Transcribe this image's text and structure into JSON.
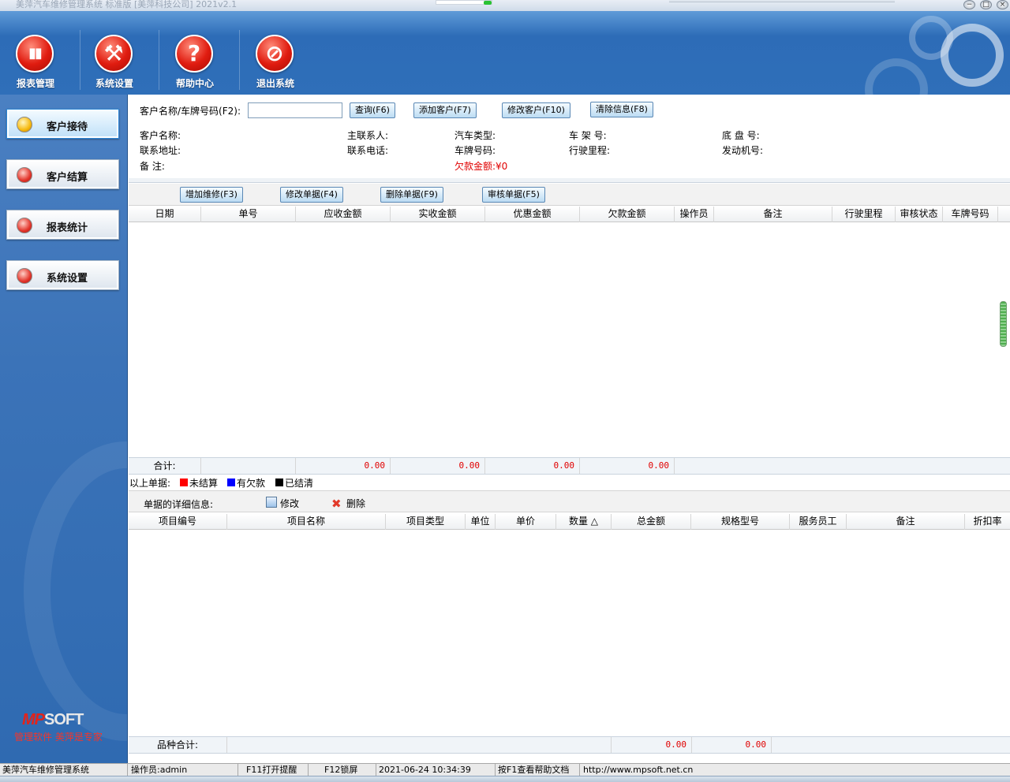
{
  "window": {
    "title": "美萍汽车维修管理系统 标准版 [美萍科技公司]    2021v2.1",
    "controls": [
      "−",
      "□",
      "×"
    ]
  },
  "toolbar": {
    "items": [
      {
        "label": "报表管理",
        "icon": "bar-chart-icon",
        "glyph": "▮▮"
      },
      {
        "label": "系统设置",
        "icon": "tools-icon",
        "glyph": "⚒"
      },
      {
        "label": "帮助中心",
        "icon": "help-icon",
        "glyph": "?"
      },
      {
        "label": "退出系统",
        "icon": "exit-icon",
        "glyph": "⊘"
      }
    ]
  },
  "sidebar": {
    "items": [
      {
        "label": "客户接待",
        "active": true
      },
      {
        "label": "客户结算",
        "active": false
      },
      {
        "label": "报表统计",
        "active": false
      },
      {
        "label": "系统设置",
        "active": false
      }
    ],
    "logo_prefix": "MP",
    "logo_suffix": "SOFT",
    "slogan": "管理软件 美萍是专家"
  },
  "search": {
    "label": "客户名称/车牌号码(F2):",
    "value": "",
    "buttons": [
      "查询(F6)",
      "添加客户(F7)",
      "修改客户(F10)",
      "清除信息(F8)"
    ]
  },
  "customer_info": {
    "name_label": "客户名称:",
    "address_label": "联系地址:",
    "remark_label": "备    注:",
    "contact_label": "主联系人:",
    "phone_label": "联系电话:",
    "car_type_label": "汽车类型:",
    "plate_label": "车牌号码:",
    "debt_label": "欠款金额:¥0",
    "frame_label": "车 架 号:",
    "mileage_label": "行驶里程:",
    "chassis_label": "底 盘 号:",
    "engine_label": "发动机号:"
  },
  "order_actions": [
    "增加维修(F3)",
    "修改单据(F4)",
    "删除单据(F9)",
    "审核单据(F5)"
  ],
  "orders_table": {
    "columns": [
      "日期",
      "单号",
      "应收金额",
      "实收金额",
      "优惠金额",
      "欠款金额",
      "操作员",
      "备注",
      "行驶里程",
      "审核状态",
      "车牌号码"
    ],
    "rows": [],
    "total_label": "合计:",
    "totals": [
      "0.00",
      "0.00",
      "0.00",
      "0.00"
    ]
  },
  "legend": {
    "prefix": "以上单据:",
    "items": [
      {
        "label": "未结算",
        "color": "#ff0000"
      },
      {
        "label": "有欠款",
        "color": "#0000ff"
      },
      {
        "label": "已结清",
        "color": "#000000"
      }
    ]
  },
  "detail": {
    "title": "单据的详细信息:",
    "edit_label": "修改",
    "delete_label": "删除",
    "columns": [
      "项目编号",
      "项目名称",
      "项目类型",
      "单位",
      "单价",
      "数量 △",
      "总金额",
      "规格型号",
      "服务员工",
      "备注",
      "折扣率"
    ],
    "rows": [],
    "total_label": "品种合计:",
    "totals": [
      "0.00",
      "0.00"
    ]
  },
  "statusbar": {
    "app": "美萍汽车维修管理系统",
    "operator": "操作员:admin",
    "f11": "F11打开提醒",
    "f12": "F12锁屏",
    "datetime": "2021-06-24 10:34:39",
    "help": "按F1查看帮助文档",
    "url": "http://www.mpsoft.net.cn"
  }
}
